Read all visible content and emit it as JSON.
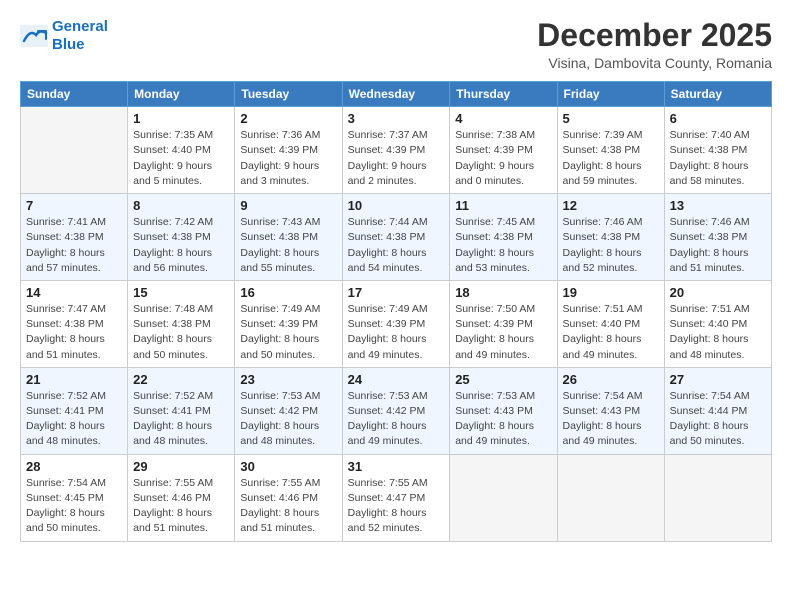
{
  "header": {
    "logo_line1": "General",
    "logo_line2": "Blue",
    "month_title": "December 2025",
    "subtitle": "Visina, Dambovita County, Romania"
  },
  "weekdays": [
    "Sunday",
    "Monday",
    "Tuesday",
    "Wednesday",
    "Thursday",
    "Friday",
    "Saturday"
  ],
  "weeks": [
    [
      {
        "day": "",
        "empty": true
      },
      {
        "day": "1",
        "sunrise": "7:35 AM",
        "sunset": "4:40 PM",
        "daylight": "9 hours and 5 minutes."
      },
      {
        "day": "2",
        "sunrise": "7:36 AM",
        "sunset": "4:39 PM",
        "daylight": "9 hours and 3 minutes."
      },
      {
        "day": "3",
        "sunrise": "7:37 AM",
        "sunset": "4:39 PM",
        "daylight": "9 hours and 2 minutes."
      },
      {
        "day": "4",
        "sunrise": "7:38 AM",
        "sunset": "4:39 PM",
        "daylight": "9 hours and 0 minutes."
      },
      {
        "day": "5",
        "sunrise": "7:39 AM",
        "sunset": "4:38 PM",
        "daylight": "8 hours and 59 minutes."
      },
      {
        "day": "6",
        "sunrise": "7:40 AM",
        "sunset": "4:38 PM",
        "daylight": "8 hours and 58 minutes."
      }
    ],
    [
      {
        "day": "7",
        "sunrise": "7:41 AM",
        "sunset": "4:38 PM",
        "daylight": "8 hours and 57 minutes."
      },
      {
        "day": "8",
        "sunrise": "7:42 AM",
        "sunset": "4:38 PM",
        "daylight": "8 hours and 56 minutes."
      },
      {
        "day": "9",
        "sunrise": "7:43 AM",
        "sunset": "4:38 PM",
        "daylight": "8 hours and 55 minutes."
      },
      {
        "day": "10",
        "sunrise": "7:44 AM",
        "sunset": "4:38 PM",
        "daylight": "8 hours and 54 minutes."
      },
      {
        "day": "11",
        "sunrise": "7:45 AM",
        "sunset": "4:38 PM",
        "daylight": "8 hours and 53 minutes."
      },
      {
        "day": "12",
        "sunrise": "7:46 AM",
        "sunset": "4:38 PM",
        "daylight": "8 hours and 52 minutes."
      },
      {
        "day": "13",
        "sunrise": "7:46 AM",
        "sunset": "4:38 PM",
        "daylight": "8 hours and 51 minutes."
      }
    ],
    [
      {
        "day": "14",
        "sunrise": "7:47 AM",
        "sunset": "4:38 PM",
        "daylight": "8 hours and 51 minutes."
      },
      {
        "day": "15",
        "sunrise": "7:48 AM",
        "sunset": "4:38 PM",
        "daylight": "8 hours and 50 minutes."
      },
      {
        "day": "16",
        "sunrise": "7:49 AM",
        "sunset": "4:39 PM",
        "daylight": "8 hours and 50 minutes."
      },
      {
        "day": "17",
        "sunrise": "7:49 AM",
        "sunset": "4:39 PM",
        "daylight": "8 hours and 49 minutes."
      },
      {
        "day": "18",
        "sunrise": "7:50 AM",
        "sunset": "4:39 PM",
        "daylight": "8 hours and 49 minutes."
      },
      {
        "day": "19",
        "sunrise": "7:51 AM",
        "sunset": "4:40 PM",
        "daylight": "8 hours and 49 minutes."
      },
      {
        "day": "20",
        "sunrise": "7:51 AM",
        "sunset": "4:40 PM",
        "daylight": "8 hours and 48 minutes."
      }
    ],
    [
      {
        "day": "21",
        "sunrise": "7:52 AM",
        "sunset": "4:41 PM",
        "daylight": "8 hours and 48 minutes."
      },
      {
        "day": "22",
        "sunrise": "7:52 AM",
        "sunset": "4:41 PM",
        "daylight": "8 hours and 48 minutes."
      },
      {
        "day": "23",
        "sunrise": "7:53 AM",
        "sunset": "4:42 PM",
        "daylight": "8 hours and 48 minutes."
      },
      {
        "day": "24",
        "sunrise": "7:53 AM",
        "sunset": "4:42 PM",
        "daylight": "8 hours and 49 minutes."
      },
      {
        "day": "25",
        "sunrise": "7:53 AM",
        "sunset": "4:43 PM",
        "daylight": "8 hours and 49 minutes."
      },
      {
        "day": "26",
        "sunrise": "7:54 AM",
        "sunset": "4:43 PM",
        "daylight": "8 hours and 49 minutes."
      },
      {
        "day": "27",
        "sunrise": "7:54 AM",
        "sunset": "4:44 PM",
        "daylight": "8 hours and 50 minutes."
      }
    ],
    [
      {
        "day": "28",
        "sunrise": "7:54 AM",
        "sunset": "4:45 PM",
        "daylight": "8 hours and 50 minutes."
      },
      {
        "day": "29",
        "sunrise": "7:55 AM",
        "sunset": "4:46 PM",
        "daylight": "8 hours and 51 minutes."
      },
      {
        "day": "30",
        "sunrise": "7:55 AM",
        "sunset": "4:46 PM",
        "daylight": "8 hours and 51 minutes."
      },
      {
        "day": "31",
        "sunrise": "7:55 AM",
        "sunset": "4:47 PM",
        "daylight": "8 hours and 52 minutes."
      },
      {
        "day": "",
        "empty": true
      },
      {
        "day": "",
        "empty": true
      },
      {
        "day": "",
        "empty": true
      }
    ]
  ],
  "logo": {
    "line1": "General",
    "line2": "Blue"
  }
}
